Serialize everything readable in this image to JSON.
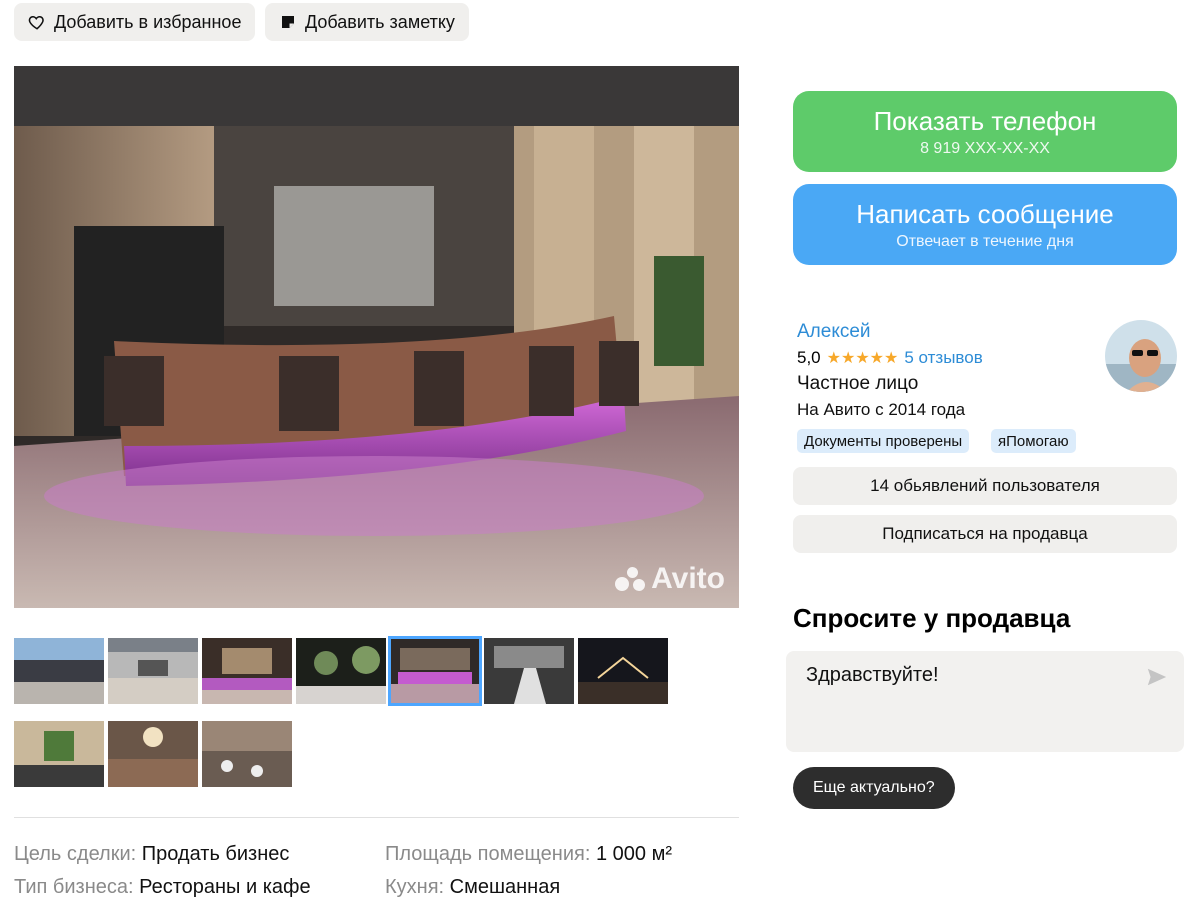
{
  "top_actions": {
    "favorite_label": "Добавить в избранное",
    "note_label": "Добавить заметку"
  },
  "gallery": {
    "watermark": "Avito",
    "thumbnails": [
      {
        "icon": "thumb-building-exterior",
        "active": false
      },
      {
        "icon": "thumb-hall-interior",
        "active": false
      },
      {
        "icon": "thumb-bar-purple",
        "active": false
      },
      {
        "icon": "thumb-wedding-decor",
        "active": false
      },
      {
        "icon": "thumb-bar-counter",
        "active": true
      },
      {
        "icon": "thumb-wedding-bw",
        "active": false
      },
      {
        "icon": "thumb-night-terrace",
        "active": false
      },
      {
        "icon": "thumb-green-wall",
        "active": false
      },
      {
        "icon": "thumb-banquet-hall",
        "active": false
      },
      {
        "icon": "thumb-hall-tables",
        "active": false
      }
    ]
  },
  "params": {
    "goal_key": "Цель сделки:",
    "goal_value": "Продать бизнес",
    "area_key": "Площадь помещения:",
    "area_value": "1 000 м²",
    "type_key": "Тип бизнеса:",
    "type_value": "Рестораны и кафе",
    "kitchen_key": "Кухня:",
    "kitchen_value": "Смешанная"
  },
  "contact": {
    "phone_title": "Показать телефон",
    "phone_masked": "8 919 XXX-XX-XX",
    "message_title": "Написать сообщение",
    "message_sub": "Отвечает в течение дня",
    "colors": {
      "phone": "#5ecb6a",
      "message": "#4aa8f5"
    }
  },
  "seller": {
    "name": "Алексей",
    "rating": "5,0",
    "rating_stars": 5,
    "reviews": "5 отзывов",
    "type": "Частное лицо",
    "since": "На Авито с 2014 года",
    "badges": [
      "Документы проверены",
      "яПомогаю"
    ],
    "listings_button": "14 обьявлений пользователя",
    "subscribe_button": "Подписаться на продавца"
  },
  "ask": {
    "title": "Спросите у продавца",
    "message_value": "Здравствуйте!",
    "quick_reply": "Еще актуально?"
  }
}
